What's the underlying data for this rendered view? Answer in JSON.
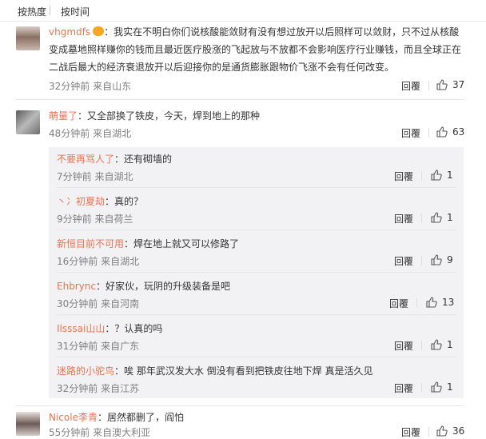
{
  "sort": {
    "hot": "按热度",
    "time": "按时间"
  },
  "ui": {
    "reply": "回覆"
  },
  "comments": [
    {
      "user": "vhgmdfs",
      "text_lines": [
        "：我实在不明白你们说核酸能敛财有没有想过放开以后照样可以敛财，只不过从核酸",
        "变成墓地照样赚你的钱而且最近医疗股涨的飞起放与不放都不会影响医疗行业赚钱，而且全球正在",
        "二战后最大的经济衰退放开以后迎接你的是通货膨胀跟物价飞涨不会有任何改变。"
      ],
      "time": "32分钟前",
      "location": "来自山东",
      "likes": "37"
    },
    {
      "user": "萌量了",
      "text": "：又全部换了铁皮，今天，焊到地上的那种",
      "time": "48分钟前",
      "location": "来自湖北",
      "likes": "63"
    },
    {
      "user": "Nicole李青",
      "text": "：居然都删了，阎怕",
      "time": "55分钟前",
      "location": "来自澳大利亚",
      "likes": "36"
    }
  ],
  "replies": [
    {
      "user": "不要再骂人了",
      "text": "：还有砌墙的",
      "time": "7分钟前",
      "location": "来自湖北",
      "likes": "1"
    },
    {
      "user": "丶冫初夏劫",
      "text": "：真的？",
      "time": "9分钟前",
      "location": "来自荷兰",
      "likes": "1"
    },
    {
      "user": "新恒目前不可用",
      "text": "：焊在地上就又可以修路了",
      "time": "16分钟前",
      "location": "来自湖北",
      "likes": "9"
    },
    {
      "user": "Ehbrync",
      "text": "：好家伙，玩阴的升级装备是吧",
      "time": "30分钟前",
      "location": "来自河南",
      "likes": "13"
    },
    {
      "user": "Ilsssai山山",
      "text": "：？认真的吗",
      "time": "31分钟前",
      "location": "来自广东",
      "likes": "1"
    },
    {
      "user": "迷路的小驼鸟",
      "text": "：唉 那年武汉发大水 倒没有看到把铁皮往地下焊 真是活久见",
      "time": "32分钟前",
      "location": "来自江苏",
      "likes": "1"
    }
  ]
}
